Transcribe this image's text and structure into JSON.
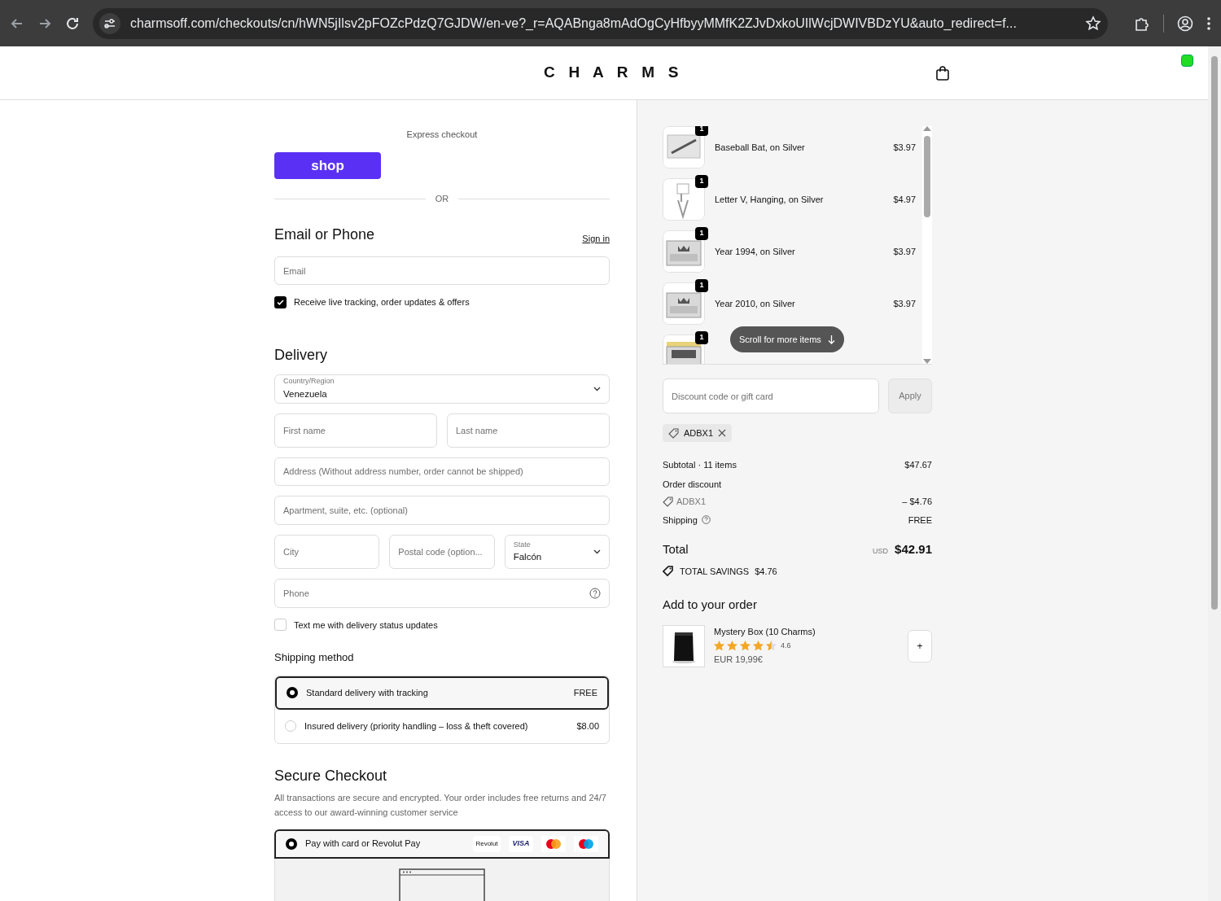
{
  "browser": {
    "url": "charmsoff.com/checkouts/cn/hWN5jIlsv2pFOZcPdzQ7GJDW/en-ve?_r=AQABnga8mAdOgCyHfbyyMMfK2ZJvDxkoUIlWcjDWIVBDzYU&auto_redirect=f..."
  },
  "header": {
    "logo": "C H A R M S"
  },
  "express": {
    "label": "Express checkout",
    "button": "shop",
    "divider": "OR"
  },
  "contact": {
    "title": "Email or Phone",
    "sign_in": "Sign in",
    "email_placeholder": "Email",
    "marketing": {
      "label": "Receive live tracking, order updates & offers",
      "checked": true
    }
  },
  "delivery": {
    "title": "Delivery",
    "fields": [
      {
        "kind": "select",
        "label": "Country/Region",
        "value": "Venezuela"
      },
      {
        "kind": "row",
        "fields": [
          {
            "kind": "input",
            "placeholder": "First name"
          },
          {
            "kind": "input",
            "placeholder": "Last name"
          }
        ]
      },
      {
        "kind": "input",
        "placeholder": "Address (Without address number, order cannot be shipped)"
      },
      {
        "kind": "input",
        "placeholder": "Apartment, suite, etc. (optional)"
      },
      {
        "kind": "row",
        "fields": [
          {
            "kind": "input",
            "placeholder": "City"
          },
          {
            "kind": "input",
            "placeholder": "Postal code (option..."
          },
          {
            "kind": "select",
            "label": "State",
            "value": "Falcón"
          }
        ]
      },
      {
        "kind": "help",
        "placeholder": "Phone"
      }
    ],
    "sms": {
      "label": "Text me with delivery status updates",
      "checked": false
    }
  },
  "shipping": {
    "title": "Shipping method",
    "options": [
      {
        "label": "Standard delivery with tracking",
        "price": "FREE",
        "selected": true
      },
      {
        "label": "Insured delivery (priority handling – loss & theft covered)",
        "price": "$8.00",
        "selected": false
      }
    ]
  },
  "payment": {
    "title": "Secure Checkout",
    "note": "All transactions are secure and encrypted. Your order includes free returns and 24/7 access to our award-winning customer service",
    "options": [
      {
        "label": "Pay with card or Revolut Pay",
        "selected": true,
        "badges": [
          {
            "kind": "text",
            "label": "Revolut"
          },
          {
            "kind": "visa",
            "label": "VISA"
          },
          {
            "kind": "mastercard"
          },
          {
            "kind": "maestro"
          }
        ]
      }
    ]
  },
  "order": {
    "items": [
      {
        "name": "Baseball Bat, on Silver",
        "price": "$3.97",
        "quantity": "1"
      },
      {
        "name": "Letter V, Hanging, on Silver",
        "price": "$4.97",
        "quantity": "1"
      },
      {
        "name": "Year 1994, on Silver",
        "price": "$3.97",
        "quantity": "1"
      },
      {
        "name": "Year 2010, on Silver",
        "price": "$3.97",
        "quantity": "1"
      },
      {
        "quantity": "1"
      }
    ],
    "scroll_hint": "Scroll for more items",
    "discount": {
      "placeholder": "Discount code or gift card",
      "button": "Apply",
      "applied": "ADBX1"
    },
    "summary": {
      "subtotal_label": "Subtotal · 11 items",
      "subtotal": "$47.67",
      "discount_label": "Order discount",
      "discount_code": "ADBX1",
      "discount": "– $4.76",
      "shipping_label": "Shipping",
      "shipping": "FREE",
      "total_label": "Total",
      "currency": "USD",
      "total": "$42.91",
      "savings_label": "TOTAL SAVINGS",
      "savings": "$4.76"
    },
    "upsell": {
      "title": "Add to your order",
      "products": [
        {
          "name": "Mystery Box (10 Charms)",
          "stars": 4.5,
          "rating": "4.6",
          "price": "EUR 19,99€",
          "button": "+"
        }
      ]
    }
  }
}
